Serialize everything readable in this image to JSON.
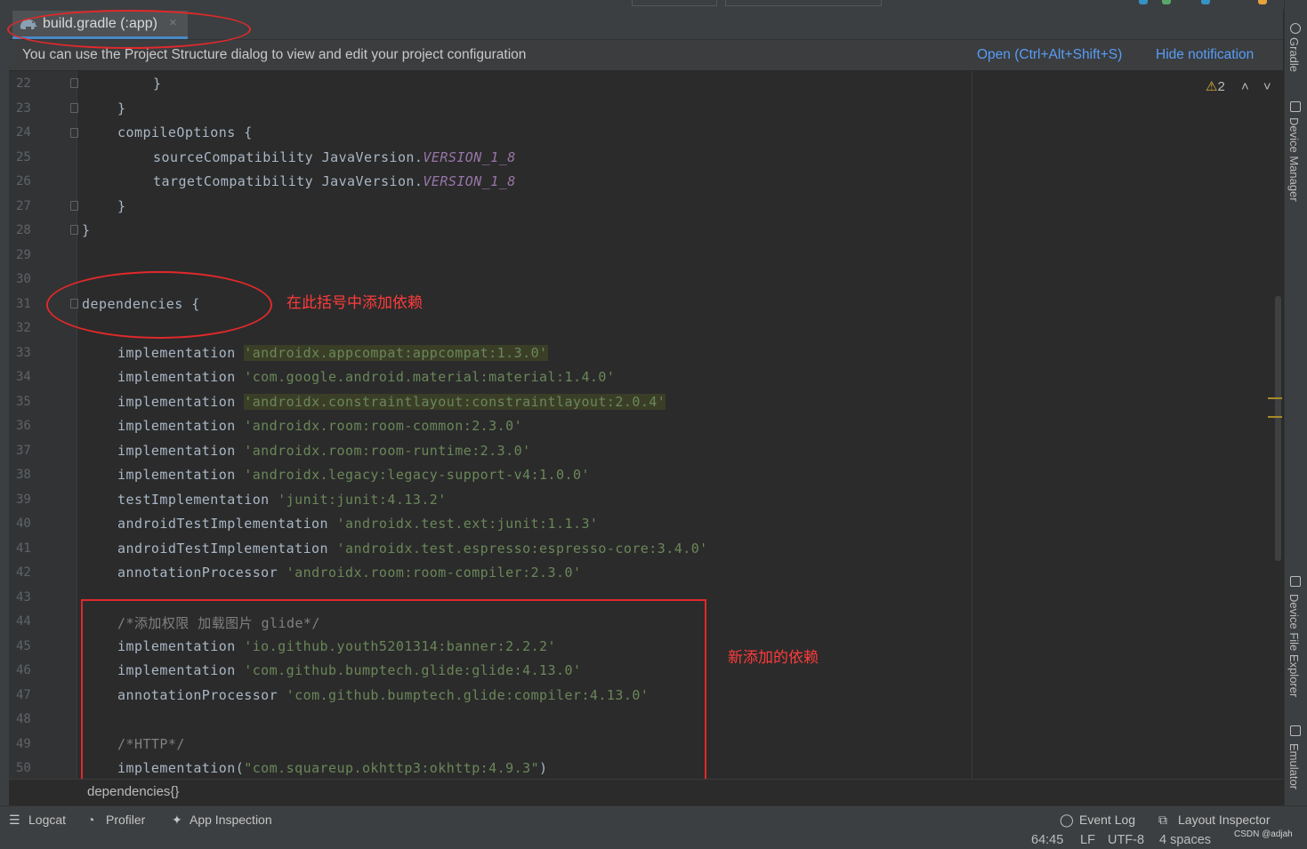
{
  "toolbar": {},
  "tab": {
    "label": "build.gradle (:app)",
    "close": "×",
    "icon": "gradle-elephant-icon"
  },
  "notification": {
    "text": "You can use the Project Structure dialog to view and edit your project configuration",
    "open_link": "Open (Ctrl+Alt+Shift+S)",
    "hide_link": "Hide notification"
  },
  "inspections": {
    "warning_count": "2",
    "warning_icon": "⚠",
    "up": "˄",
    "down": "˅"
  },
  "editor": {
    "line_numbers": [
      "22",
      "23",
      "24",
      "25",
      "26",
      "27",
      "28",
      "29",
      "30",
      "31",
      "32",
      "33",
      "34",
      "35",
      "36",
      "37",
      "38",
      "39",
      "40",
      "41",
      "42",
      "43",
      "44",
      "45",
      "46",
      "47",
      "48",
      "49",
      "50"
    ],
    "lines": {
      "l22": "}",
      "l23": "}",
      "l24": "compileOptions {",
      "l25_a": "sourceCompatibility JavaVersion.",
      "l25_b": "VERSION_1_8",
      "l26_a": "targetCompatibility JavaVersion.",
      "l26_b": "VERSION_1_8",
      "l27": "}",
      "l28": "}",
      "l31": "dependencies {",
      "l33_a": "implementation ",
      "l33_b": "'androidx.appcompat:appcompat:1.3.0'",
      "l34_a": "implementation ",
      "l34_b": "'com.google.android.material:material:1.4.0'",
      "l35_a": "implementation ",
      "l35_b": "'androidx.constraintlayout:constraintlayout:2.0.4'",
      "l36_a": "implementation ",
      "l36_b": "'androidx.room:room-common:2.3.0'",
      "l37_a": "implementation ",
      "l37_b": "'androidx.room:room-runtime:2.3.0'",
      "l38_a": "implementation ",
      "l38_b": "'androidx.legacy:legacy-support-v4:1.0.0'",
      "l39_a": "testImplementation ",
      "l39_b": "'junit:junit:4.13.2'",
      "l40_a": "androidTestImplementation ",
      "l40_b": "'androidx.test.ext:junit:1.1.3'",
      "l41_a": "androidTestImplementation ",
      "l41_b": "'androidx.test.espresso:espresso-core:3.4.0'",
      "l42_a": "annotationProcessor ",
      "l42_b": "'androidx.room:room-compiler:2.3.0'",
      "l44": "/*添加权限 加载图片 glide*/",
      "l45_a": "implementation ",
      "l45_b": "'io.github.youth5201314:banner:2.2.2'",
      "l46_a": "implementation ",
      "l46_b": "'com.github.bumptech.glide:glide:4.13.0'",
      "l47_a": "annotationProcessor ",
      "l47_b": "'com.github.bumptech.glide:compiler:4.13.0'",
      "l49": "/*HTTP*/",
      "l50_a": "implementation(",
      "l50_b": "\"com.squareup.okhttp3:okhttp:4.9.3\"",
      "l50_c": ")"
    }
  },
  "breadcrumb": "dependencies{}",
  "right_tools": [
    "Gradle",
    "Device Manager",
    "Device File Explorer",
    "Emulator"
  ],
  "bottom_tools": {
    "logcat": "Logcat",
    "profiler": "Profiler",
    "app_inspection": "App Inspection",
    "event_log": "Event Log",
    "layout_inspector": "Layout Inspector"
  },
  "status": {
    "position": "64:45",
    "line_sep": "LF",
    "encoding": "UTF-8",
    "indent": "4 spaces"
  },
  "watermark": "CSDN @adjah",
  "annotations": {
    "add_here": "在此括号中添加依赖",
    "new_deps": "新添加的依赖",
    "color": "#e0292b"
  },
  "colors": {
    "string": "#6a8759",
    "constant": "#9876aa",
    "link": "#589df6",
    "accent": "#4a88c7"
  }
}
